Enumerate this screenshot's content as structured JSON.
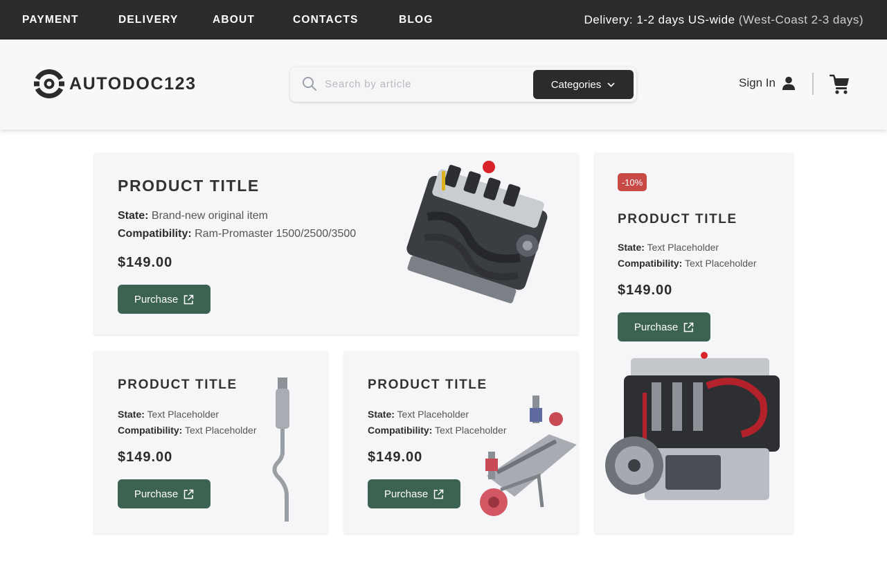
{
  "topbar": {
    "nav": [
      "PAYMENT",
      "DELIVERY",
      "ABOUT",
      "CONTACTS",
      "BLOG"
    ],
    "delivery_main": "Delivery: 1-2 days US-wide",
    "delivery_note": "(West-Coast 2-3 days)"
  },
  "header": {
    "logo": "AUTODOC123",
    "search_placeholder": "Search by article",
    "categories_label": "Categories",
    "signin_label": "Sign In"
  },
  "products": [
    {
      "title": "PRODUCT TITLE",
      "state_label": "State:",
      "state": "Brand-new original item",
      "compat_label": "Compatibility:",
      "compat": "Ram-Promaster 1500/2500/3500",
      "price": "$149.00",
      "button": "Purchase",
      "image": "engine-image"
    },
    {
      "badge": "-10%",
      "title": "PRODUCT TITLE",
      "state_label": "State:",
      "state": "Text Placeholder",
      "compat_label": "Compatibility:",
      "compat": "Text Placeholder",
      "price": "$149.00",
      "button": "Purchase",
      "image": "engine-cutaway-image"
    },
    {
      "title": "PRODUCT TITLE",
      "state_label": "State:",
      "state": "Text Placeholder",
      "compat_label": "Compatibility:",
      "compat": "Text Placeholder",
      "price": "$149.00",
      "button": "Purchase",
      "image": "exhaust-pipe-image"
    },
    {
      "title": "PRODUCT TITLE",
      "state_label": "State:",
      "state": "Text Placeholder",
      "compat_label": "Compatibility:",
      "compat": "Text Placeholder",
      "price": "$149.00",
      "button": "Purchase",
      "image": "suspension-image"
    }
  ],
  "colors": {
    "topbar": "#2c2c2c",
    "accent_button": "#3c6252",
    "badge": "#c84a47",
    "card": "#f6f6f8"
  },
  "icons": [
    "logo-mark-icon",
    "search-icon",
    "chevron-down-icon",
    "user-icon",
    "cart-icon",
    "external-link-icon"
  ]
}
